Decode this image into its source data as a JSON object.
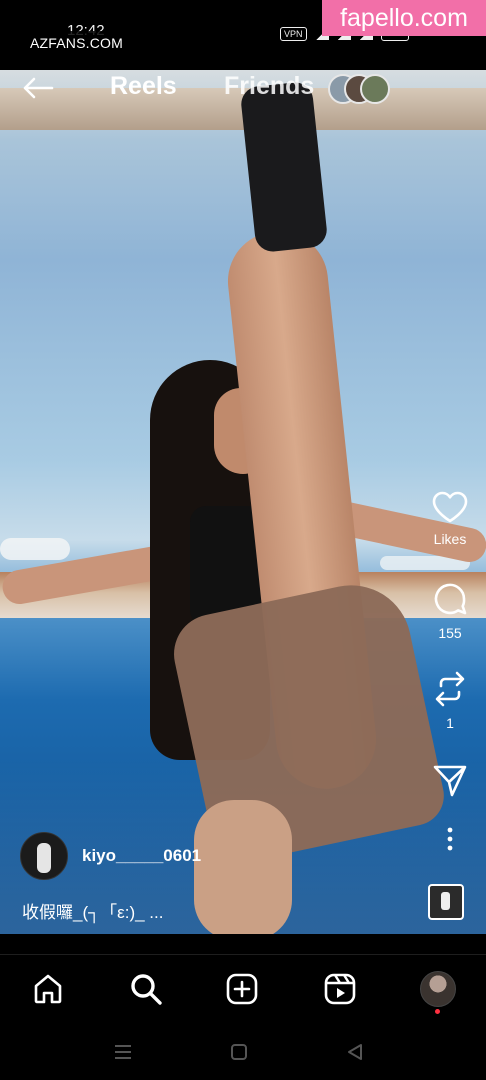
{
  "status_bar": {
    "time": "12:42",
    "vpn_label": "VPN"
  },
  "watermarks": {
    "left": "AZFANS.COM",
    "right": "fapello.com"
  },
  "header": {
    "back_icon": "arrow-left-icon",
    "tab_reels": "Reels",
    "tab_friends": "Friends"
  },
  "actions": {
    "like_label": "Likes",
    "comment_count": "155",
    "repost_count": "1",
    "icons": [
      "heart-icon",
      "comment-icon",
      "repost-icon",
      "send-icon",
      "more-icon"
    ]
  },
  "post": {
    "username": "kiyo_____0601",
    "caption": "收假囉_(┐「ε:)_ ..."
  },
  "bottom_nav": {
    "icons": [
      "home-icon",
      "search-icon",
      "create-icon",
      "reels-icon",
      "profile-avatar"
    ]
  },
  "colors": {
    "watermark_pink": "#f26fa8",
    "notification_dot": "#ff3040"
  }
}
